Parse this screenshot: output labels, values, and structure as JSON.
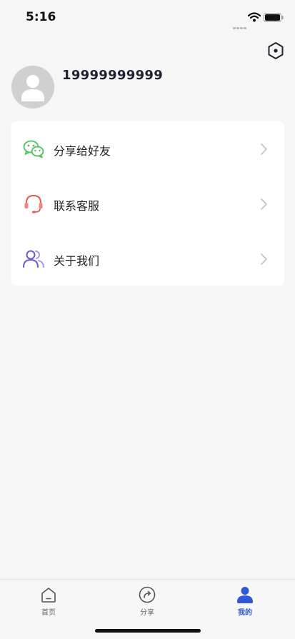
{
  "status_bar": {
    "time": "5:16",
    "icons": [
      "cellular-signal-icon",
      "wifi-icon",
      "battery-icon"
    ]
  },
  "header": {
    "settings_icon": "hexagon-settings-icon"
  },
  "profile": {
    "avatar_icon": "default-user-avatar-icon",
    "phone": "19999999999"
  },
  "menu": {
    "items": [
      {
        "label": "分享给好友",
        "icon": "wechat-icon",
        "color": "#4cc35f"
      },
      {
        "label": "联系客服",
        "icon": "headset-icon",
        "color": "#e85a4f"
      },
      {
        "label": "关于我们",
        "icon": "users-icon",
        "color": "#6b5bd6"
      }
    ]
  },
  "tabs": [
    {
      "label": "首页",
      "icon": "home-icon",
      "active": false
    },
    {
      "label": "分享",
      "icon": "share-icon",
      "active": false
    },
    {
      "label": "我的",
      "icon": "profile-icon",
      "active": true
    }
  ],
  "colors": {
    "background": "#f6f6f6",
    "card": "#ffffff",
    "accent": "#2f57d6"
  }
}
